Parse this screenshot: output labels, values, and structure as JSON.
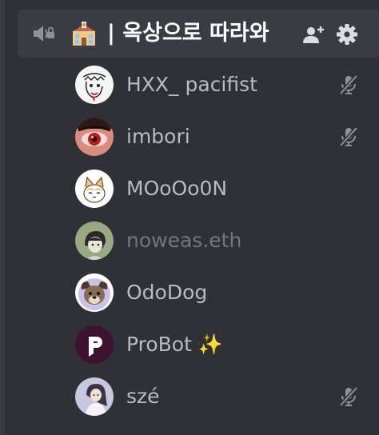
{
  "channel": {
    "icon": "speaker-locked-icon",
    "emoji": "school-emoji",
    "name": "| 옥상으로 따라와",
    "invite_icon": "add-member-icon",
    "settings_icon": "gear-icon"
  },
  "members": [
    {
      "name": "HXX_ pacifist",
      "muted": true,
      "dim": false,
      "avatar": "sketch-avatar"
    },
    {
      "name": "imbori",
      "muted": true,
      "dim": false,
      "avatar": "red-eye-avatar"
    },
    {
      "name": "MOoOo0N",
      "muted": false,
      "dim": false,
      "avatar": "cat-avatar"
    },
    {
      "name": "noweas.eth",
      "muted": false,
      "dim": true,
      "avatar": "character-avatar"
    },
    {
      "name": "OdoDog",
      "muted": false,
      "dim": false,
      "avatar": "dog-avatar"
    },
    {
      "name": "ProBot ✨",
      "muted": false,
      "dim": false,
      "avatar": "probot-avatar"
    },
    {
      "name": "szé",
      "muted": true,
      "dim": false,
      "avatar": "girl-avatar"
    }
  ],
  "colors": {
    "background": "#2f3136",
    "header": "#393c43",
    "text": "#b9bbbe",
    "dim_text": "#72767d",
    "icon": "#b9bbbe"
  }
}
